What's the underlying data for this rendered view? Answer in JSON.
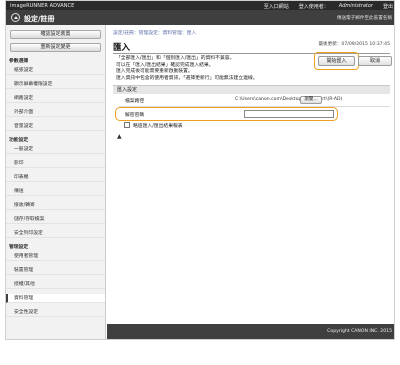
{
  "header": {
    "brand": "imageRUNNER ADVANCE",
    "top_links": [
      "至入口網站",
      "登入使用者：",
      "Administrator",
      "登出"
    ],
    "app_title": "設定/註冊",
    "device_name": "傳送電子郵件至此裝置名稱"
  },
  "sidebar": {
    "buttons": [
      "確認設定裝置",
      "重新設定變更"
    ],
    "sections": [
      {
        "heading": "參數選擇",
        "items": [
          "紙張設定",
          "顯示屏幕權限設定",
          "網路設定",
          "外部介面",
          "音量設定"
        ]
      },
      {
        "heading": "功能設定",
        "items": [
          "一般設定",
          "影印",
          "印表機",
          "傳送",
          "接收/轉寄",
          "儲存/存取檔案",
          "安全列印設定"
        ]
      },
      {
        "heading": "管理設定",
        "items": [
          "使用者管理",
          "裝置管理",
          "授權/其他",
          "資料管理",
          "安全性設定"
        ]
      }
    ],
    "active_item": "資料管理"
  },
  "main": {
    "breadcrumb": "設定/註冊：管理設定：資料管理：匯入",
    "page_title": "匯入",
    "last_updated": "最後更新：07/09/2015 10:37:45",
    "start_import_label": "開始匯入",
    "cancel_label": "取消",
    "notes": [
      "「全部匯入/匯出」和「個別匯入/匯出」的資料不兼容。",
      "可以在「匯入/匯出結果」確認完成匯入結果。",
      "匯入完成後可能需要重新啟動裝置。",
      "匯入資訊中包含的使用者資訊，「選擇更新行」可能無法建立連線。"
    ],
    "section_heading": "匯入設定",
    "file_path_label": "檔案路徑",
    "file_path_value": "C:\\Users\\canon.com\\Desktop\\for import\\(R-AD)",
    "browse_label": "瀏覽...",
    "password_label": "解密密碼",
    "password_value": "",
    "skip_label": "略過匯入/匯出結果報表",
    "skip_checked": false,
    "to_top_symbol": "▲"
  },
  "footer": {
    "copyright": "Copyright CANON INC. 2015"
  }
}
